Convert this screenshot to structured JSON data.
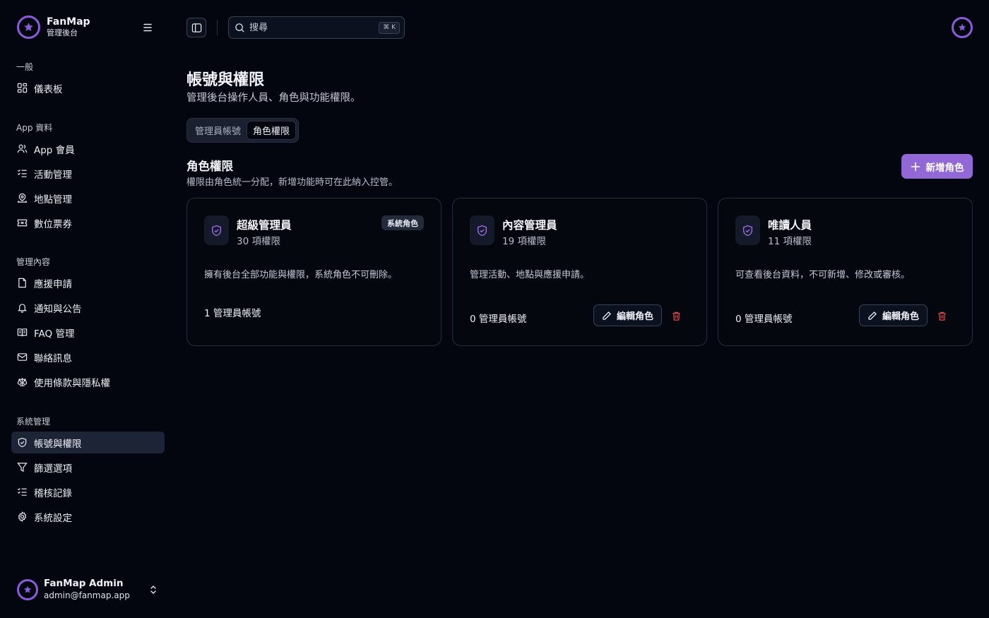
{
  "brand": {
    "name": "FanMap",
    "subtitle": "管理後台"
  },
  "sidebar": {
    "sections": [
      {
        "label": "一般",
        "items": [
          {
            "label": "儀表板",
            "icon": "dashboard-icon"
          }
        ]
      },
      {
        "label": "App 資料",
        "items": [
          {
            "label": "App 會員",
            "icon": "users-icon"
          },
          {
            "label": "活動管理",
            "icon": "checklist-icon"
          },
          {
            "label": "地點管理",
            "icon": "map-pin-icon"
          },
          {
            "label": "數位票券",
            "icon": "ticket-icon"
          }
        ]
      },
      {
        "label": "管理內容",
        "items": [
          {
            "label": "應援申請",
            "icon": "document-icon"
          },
          {
            "label": "通知與公告",
            "icon": "bell-icon"
          },
          {
            "label": "FAQ 管理",
            "icon": "book-icon"
          },
          {
            "label": "聯絡訊息",
            "icon": "mail-icon"
          },
          {
            "label": "使用條款與隱私權",
            "icon": "scale-icon"
          }
        ]
      },
      {
        "label": "系統管理",
        "items": [
          {
            "label": "帳號與權限",
            "icon": "shield-icon",
            "active": true
          },
          {
            "label": "篩選選項",
            "icon": "filter-icon"
          },
          {
            "label": "稽核記錄",
            "icon": "checklist-icon"
          },
          {
            "label": "系統設定",
            "icon": "gear-icon"
          }
        ]
      }
    ]
  },
  "user": {
    "name": "FanMap Admin",
    "email": "admin@fanmap.app"
  },
  "search": {
    "placeholder": "搜尋",
    "shortcut": "⌘ K"
  },
  "page": {
    "title": "帳號與權限",
    "description": "管理後台操作人員、角色與功能權限。"
  },
  "tabs": [
    {
      "label": "管理員帳號",
      "active": false
    },
    {
      "label": "角色權限",
      "active": true
    }
  ],
  "roles_section": {
    "title": "角色權限",
    "description": "權限由角色統一分配，新增功能時可在此納入控管。",
    "add_button": "新增角色"
  },
  "roles": [
    {
      "name": "超級管理員",
      "permissions": "30 項權限",
      "badge": "系統角色",
      "description": "擁有後台全部功能與權限，系統角色不可刪除。",
      "accounts": "1 管理員帳號"
    },
    {
      "name": "內容管理員",
      "permissions": "19 項權限",
      "description": "管理活動、地點與應援申請。",
      "accounts": "0 管理員帳號",
      "edit_label": "編輯角色"
    },
    {
      "name": "唯讀人員",
      "permissions": "11 項權限",
      "description": "可查看後台資料，不可新增、修改或審核。",
      "accounts": "0 管理員帳號",
      "edit_label": "編輯角色"
    }
  ],
  "colors": {
    "accent": "#9268d6",
    "danger": "#e0474a",
    "background": "#03050f"
  }
}
